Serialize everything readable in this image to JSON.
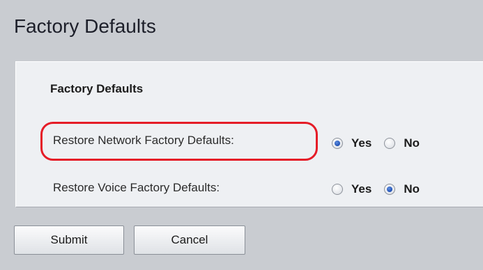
{
  "page": {
    "title": "Factory Defaults"
  },
  "section": {
    "title": "Factory Defaults"
  },
  "rows": [
    {
      "label": "Restore Network Factory Defaults:",
      "options": [
        {
          "label": "Yes",
          "selected": true
        },
        {
          "label": "No",
          "selected": false
        }
      ]
    },
    {
      "label": "Restore Voice Factory Defaults:",
      "options": [
        {
          "label": "Yes",
          "selected": false
        },
        {
          "label": "No",
          "selected": true
        }
      ]
    }
  ],
  "buttons": {
    "submit": "Submit",
    "cancel": "Cancel"
  },
  "colors": {
    "highlight": "#e51c27",
    "radio_selected": "#1e4fb3",
    "background": "#c9ccd1",
    "panel": "#eef0f3"
  }
}
